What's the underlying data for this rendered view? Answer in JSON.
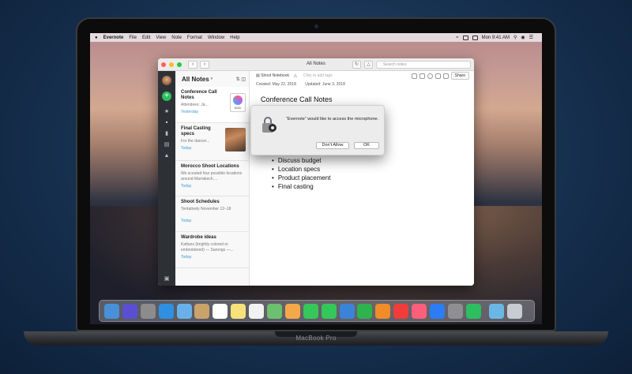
{
  "menubar": {
    "app": "Evernote",
    "items": [
      "File",
      "Edit",
      "View",
      "Note",
      "Format",
      "Window",
      "Help"
    ],
    "clock": "Mon 9:41 AM"
  },
  "window": {
    "title": "All Notes",
    "search_placeholder": "Search notes"
  },
  "notelist": {
    "header": "All Notes",
    "notes": [
      {
        "title": "Conference Call Notes",
        "snippet": "Attendees: Ja...",
        "date": "Yesterday",
        "thumb": "WAV"
      },
      {
        "title": "Final Casting specs",
        "snippet": "For the dancer...",
        "date": "Today"
      },
      {
        "title": "Morocco Shoot Locations",
        "snippet": "We scouted four possible locations around Marrakech....",
        "date": "Today"
      },
      {
        "title": "Shoot Schedules",
        "snippet": "Tentatively November 12–18",
        "date": "Today"
      },
      {
        "title": "Wardrobe ideas",
        "snippet": "Kaftans (brightly colored or embroidered) — Sarongs —...",
        "date": "Today"
      }
    ]
  },
  "editor": {
    "notebook": "Shoot Notebook",
    "tag_placeholder": "Click to add tags",
    "share": "Share",
    "created": "Created: May 22, 2018",
    "updated": "Updated: June 3, 2018",
    "title": "Conference Call Notes",
    "list": [
      "Discuss budget",
      "Location specs",
      "Product placement",
      "Final casting"
    ]
  },
  "dialog": {
    "message": "“Evernote” would like to access the microphone.",
    "deny": "Don't Allow",
    "ok": "OK"
  },
  "device": {
    "label": "MacBook Pro"
  },
  "dock": {
    "apps": [
      "finder",
      "siri",
      "launchpad",
      "safari",
      "mail",
      "contacts",
      "calendar",
      "notes",
      "reminders",
      "maps",
      "photos",
      "messages",
      "facetime",
      "keynote",
      "numbers",
      "pages",
      "news",
      "music",
      "app-store",
      "system-preferences",
      "evernote",
      "downloads",
      "trash"
    ],
    "colors": [
      "#4a90d9",
      "#5b4fd1",
      "#8c8c8c",
      "#2f8fe0",
      "#6ab0e8",
      "#c9a36a",
      "#ffffff",
      "#f5e27a",
      "#f2f2f2",
      "#6cc070",
      "#f4a84a",
      "#35c759",
      "#34c759",
      "#3b83d8",
      "#2fb34f",
      "#f28c28",
      "#f23b3b",
      "#fb5f79",
      "#2d7cf6",
      "#8e8e93",
      "#2dbe60",
      "#6ab7e6",
      "#c7ccd2"
    ]
  }
}
